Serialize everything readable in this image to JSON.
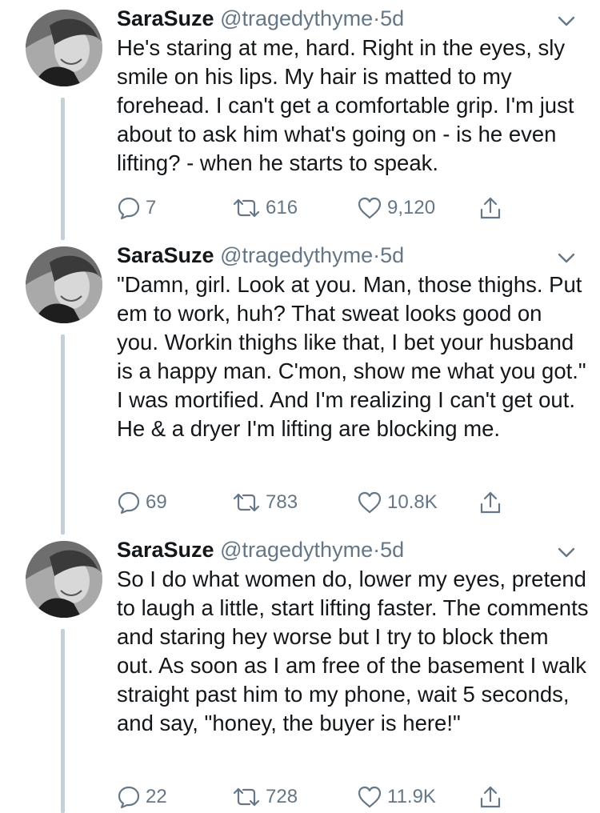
{
  "tweets": [
    {
      "name": "SaraSuze",
      "handle": "@tragedythyme",
      "separator": "·",
      "time": "5d",
      "text": "He's staring at me, hard. Right in the eyes, sly smile on his lips. My hair is matted to my forehead. I can't get a comfortable grip. I'm just about to ask him what's going on - is he even lifting? - when he starts to speak.",
      "replies": "7",
      "retweets": "616",
      "likes": "9,120"
    },
    {
      "name": "SaraSuze",
      "handle": "@tragedythyme",
      "separator": "·",
      "time": "5d",
      "text": "\"Damn, girl. Look at you. Man, those thighs. Put em to work, huh? That sweat looks good on you. Workin thighs like that, I bet your husband is a happy man. C'mon, show me what you got.\" I was mortified. And I'm realizing I can't get out. He & a dryer I'm lifting are blocking me.",
      "replies": "69",
      "retweets": "783",
      "likes": "10.8K"
    },
    {
      "name": "SaraSuze",
      "handle": "@tragedythyme",
      "separator": "·",
      "time": "5d",
      "text": "So I do what women do, lower my eyes, pretend to laugh a little, start lifting faster. The comments and staring hey worse but I try to block them out. As soon as I am free of the basement I walk straight past him to my phone, wait 5 seconds, and say, \"honey, the buyer is here!\"",
      "replies": "22",
      "retweets": "728",
      "likes": "11.9K"
    }
  ],
  "icons": {
    "avatar": "profile-photo",
    "reply": "speech-bubble-icon",
    "retweet": "retweet-arrows-icon",
    "like": "heart-outline-icon",
    "share": "share-upload-icon",
    "more": "chevron-down-icon"
  },
  "colors": {
    "text": "#14171a",
    "secondary": "#657786",
    "thread_line": "#c4cfd6"
  }
}
